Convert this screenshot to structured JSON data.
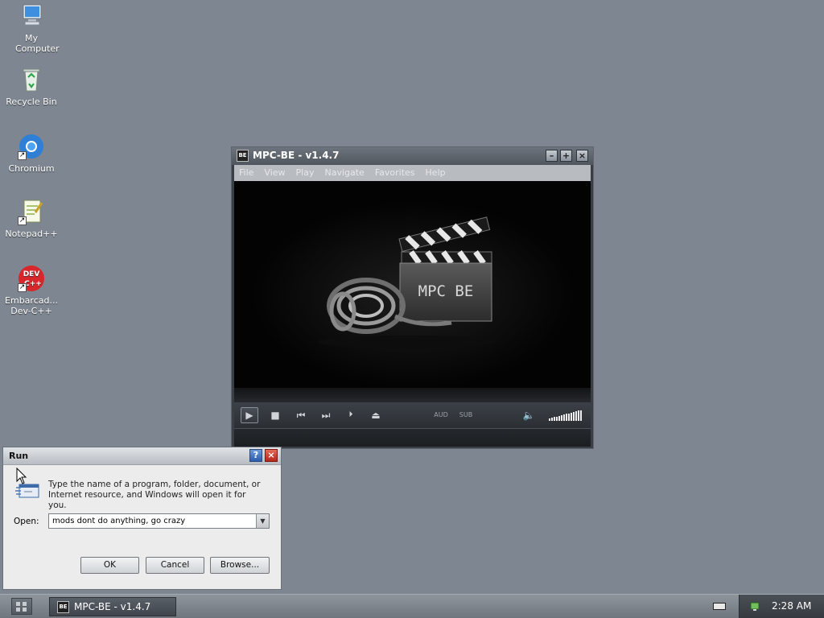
{
  "desktop": {
    "icons": [
      {
        "label": "My Computer",
        "icon": "computer-icon"
      },
      {
        "label": "Recycle Bin",
        "icon": "recycle-bin-icon"
      },
      {
        "label": "Chromium",
        "icon": "chromium-icon"
      },
      {
        "label": "Notepad++",
        "icon": "notepad-plus-plus-icon"
      },
      {
        "label": "Embarcad... Dev-C++",
        "icon": "dev-cpp-icon"
      }
    ]
  },
  "mpc": {
    "title": "MPC-BE - v1.4.7",
    "icon_text": "BE",
    "menu": [
      "File",
      "View",
      "Play",
      "Navigate",
      "Favorites",
      "Help"
    ],
    "logo_text": "MPC BE",
    "controls": {
      "aud": "AUD",
      "sub": "SUB"
    },
    "volume_level": 1.0
  },
  "run": {
    "title": "Run",
    "message": "Type the name of a program, folder, document, or Internet resource, and Windows will open it for you.",
    "open_label": "Open:",
    "open_value": "mods dont do anything, go crazy",
    "ok_label": "OK",
    "cancel_label": "Cancel",
    "browse_label": "Browse..."
  },
  "taskbar": {
    "task_label": "MPC-BE - v1.4.7",
    "clock": "2:28 AM"
  },
  "colors": {
    "desktop": "#7d8691",
    "window_frame": "#3a3f45",
    "video_bg": "#030303",
    "close_red": "#b6271b"
  }
}
